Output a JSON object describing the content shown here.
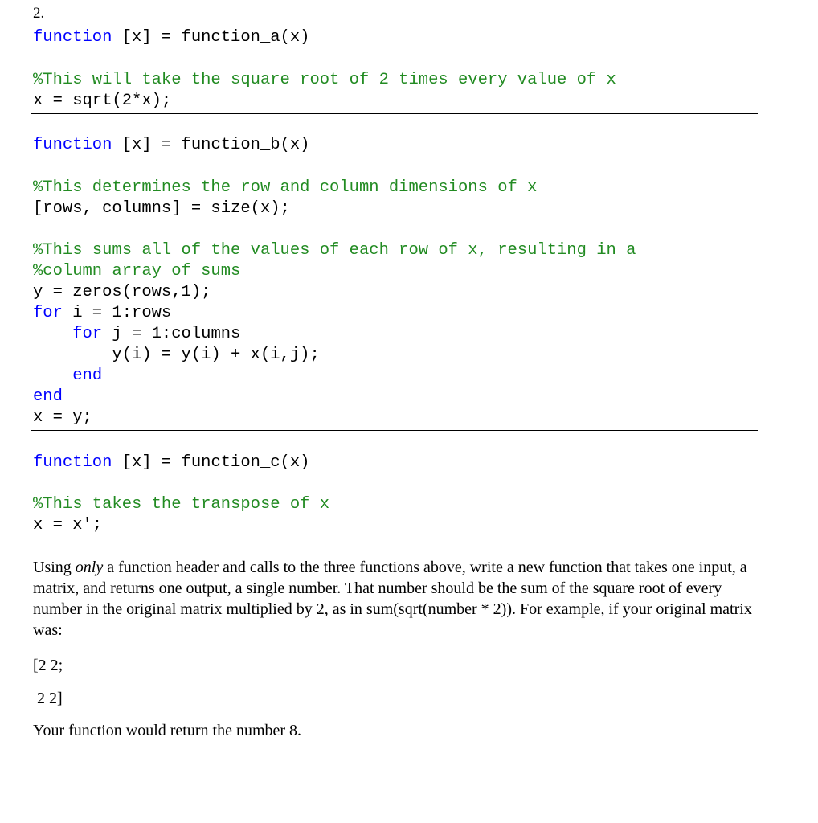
{
  "question_number": "2.",
  "function_a": {
    "header_kw": "function",
    "header_rest": " [x] = function_a(x)",
    "comment": "%This will take the square root of 2 times every value of x",
    "body": "x = sqrt(2*x);"
  },
  "function_b": {
    "header_kw": "function",
    "header_rest": " [x] = function_b(x)",
    "comment1": "%This determines the row and column dimensions of x",
    "line1": "[rows, columns] = size(x);",
    "comment2": "%This sums all of the values of each row of x, resulting in a",
    "comment3": "%column array of sums",
    "line2": "y = zeros(rows,1);",
    "for1_kw": "for",
    "for1_rest": " i = 1:rows",
    "for2_indent": "    ",
    "for2_kw": "for",
    "for2_rest": " j = 1:columns",
    "inner": "        y(i) = y(i) + x(i,j);",
    "end_inner_indent": "    ",
    "end_kw": "end",
    "last": "x = y;"
  },
  "function_c": {
    "header_kw": "function",
    "header_rest": " [x] = function_c(x)",
    "comment": "%This takes the transpose of x",
    "body": "x = x';"
  },
  "prompt": {
    "p1_a": "Using ",
    "p1_em": "only",
    "p1_b": " a function header and calls to the three functions above, write a new function that takes one input, a matrix, and returns one output, a single number. That number should be the sum of the square root of every number in the original matrix multiplied by 2, as in sum(sqrt(number * 2)). For example, if your original matrix was:",
    "matrix_line1": "[2 2;",
    "matrix_line2": " 2 2]",
    "conclusion": "Your function would return the number 8."
  }
}
